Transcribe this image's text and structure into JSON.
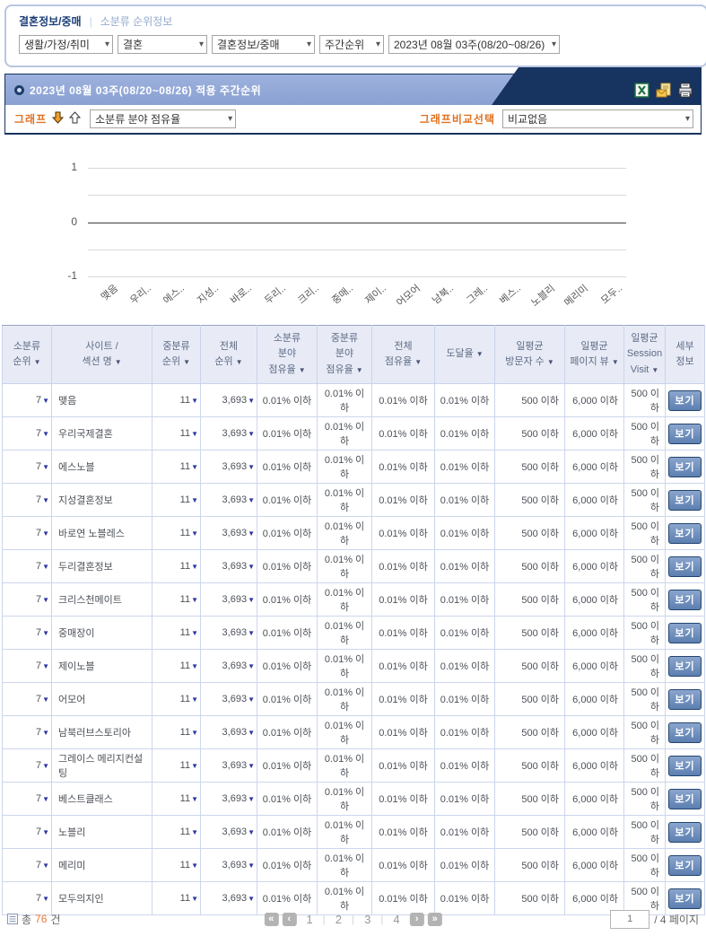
{
  "breadcrumb": {
    "category": "결혼정보/중매",
    "separator": "|",
    "section": "소분류 순위정보"
  },
  "filters": {
    "selects": [
      "생활/가정/취미",
      "결혼",
      "결혼정보/중매",
      "주간순위",
      "2023년 08월 03주(08/20~08/26)"
    ]
  },
  "panel": {
    "title": "2023년 08월 03주(08/20~08/26) 적용 주간순위",
    "toolbar_icons": [
      "excel-export-icon",
      "email-report-icon",
      "print-icon"
    ],
    "graph_label": "그래프",
    "graph_metric_select": "소분류 분야 점유율",
    "compare_label": "그래프비교선택",
    "compare_select": "비교없음"
  },
  "chart_data": {
    "type": "bar",
    "title": "",
    "xlabel": "",
    "ylabel": "",
    "categories": [
      "맺음",
      "우리..",
      "에스..",
      "지성..",
      "바로..",
      "두리..",
      "크리..",
      "중매..",
      "제이..",
      "어모어",
      "남북..",
      "그레..",
      "베스..",
      "노블리",
      "메리미",
      "모두.."
    ],
    "values": [
      0,
      0,
      0,
      0,
      0,
      0,
      0,
      0,
      0,
      0,
      0,
      0,
      0,
      0,
      0,
      0
    ],
    "ylim": [
      -1,
      1
    ],
    "yticks": [
      1,
      0,
      -1
    ],
    "gridline_values": [
      1,
      0.5,
      0,
      -0.5,
      -1
    ],
    "grid": true,
    "legend": false
  },
  "table": {
    "sort_arrow": "▼",
    "headers": [
      {
        "label": "소분류\n순위",
        "sortable": true
      },
      {
        "label": "사이트 /\n섹션 명",
        "sortable": true
      },
      {
        "label": "중분류\n순위",
        "sortable": true
      },
      {
        "label": "전체\n순위",
        "sortable": true
      },
      {
        "label": "소분류\n분야\n점유율",
        "sortable": true
      },
      {
        "label": "중분류\n분야\n점유율",
        "sortable": true
      },
      {
        "label": "전체\n점유율",
        "sortable": true
      },
      {
        "label": "도달율",
        "sortable": true
      },
      {
        "label": "일평균\n방문자 수",
        "sortable": true
      },
      {
        "label": "일평균\n페이지 뷰",
        "sortable": true
      },
      {
        "label": "일평균\nSession\nVisit",
        "sortable": true
      },
      {
        "label": "세부\n정보",
        "sortable": false
      }
    ],
    "detail_button_label": "보기",
    "rows": [
      {
        "rank": "7",
        "site": "맺음",
        "mid_rank": "11",
        "total_rank": "3,693",
        "sub_share": "0.01% 이하",
        "mid_share": "0.01% 이하",
        "total_share": "0.01% 이하",
        "reach": "0.01% 이하",
        "visitors": "500 이하",
        "pageviews": "6,000 이하",
        "sessions": "500 이하"
      },
      {
        "rank": "7",
        "site": "우리국제결혼",
        "mid_rank": "11",
        "total_rank": "3,693",
        "sub_share": "0.01% 이하",
        "mid_share": "0.01% 이하",
        "total_share": "0.01% 이하",
        "reach": "0.01% 이하",
        "visitors": "500 이하",
        "pageviews": "6,000 이하",
        "sessions": "500 이하"
      },
      {
        "rank": "7",
        "site": "에스노블",
        "mid_rank": "11",
        "total_rank": "3,693",
        "sub_share": "0.01% 이하",
        "mid_share": "0.01% 이하",
        "total_share": "0.01% 이하",
        "reach": "0.01% 이하",
        "visitors": "500 이하",
        "pageviews": "6,000 이하",
        "sessions": "500 이하"
      },
      {
        "rank": "7",
        "site": "지성결혼정보",
        "mid_rank": "11",
        "total_rank": "3,693",
        "sub_share": "0.01% 이하",
        "mid_share": "0.01% 이하",
        "total_share": "0.01% 이하",
        "reach": "0.01% 이하",
        "visitors": "500 이하",
        "pageviews": "6,000 이하",
        "sessions": "500 이하"
      },
      {
        "rank": "7",
        "site": "바로연 노블레스",
        "mid_rank": "11",
        "total_rank": "3,693",
        "sub_share": "0.01% 이하",
        "mid_share": "0.01% 이하",
        "total_share": "0.01% 이하",
        "reach": "0.01% 이하",
        "visitors": "500 이하",
        "pageviews": "6,000 이하",
        "sessions": "500 이하"
      },
      {
        "rank": "7",
        "site": "두리결혼정보",
        "mid_rank": "11",
        "total_rank": "3,693",
        "sub_share": "0.01% 이하",
        "mid_share": "0.01% 이하",
        "total_share": "0.01% 이하",
        "reach": "0.01% 이하",
        "visitors": "500 이하",
        "pageviews": "6,000 이하",
        "sessions": "500 이하"
      },
      {
        "rank": "7",
        "site": "크리스천메이트",
        "mid_rank": "11",
        "total_rank": "3,693",
        "sub_share": "0.01% 이하",
        "mid_share": "0.01% 이하",
        "total_share": "0.01% 이하",
        "reach": "0.01% 이하",
        "visitors": "500 이하",
        "pageviews": "6,000 이하",
        "sessions": "500 이하"
      },
      {
        "rank": "7",
        "site": "중매장이",
        "mid_rank": "11",
        "total_rank": "3,693",
        "sub_share": "0.01% 이하",
        "mid_share": "0.01% 이하",
        "total_share": "0.01% 이하",
        "reach": "0.01% 이하",
        "visitors": "500 이하",
        "pageviews": "6,000 이하",
        "sessions": "500 이하"
      },
      {
        "rank": "7",
        "site": "제이노블",
        "mid_rank": "11",
        "total_rank": "3,693",
        "sub_share": "0.01% 이하",
        "mid_share": "0.01% 이하",
        "total_share": "0.01% 이하",
        "reach": "0.01% 이하",
        "visitors": "500 이하",
        "pageviews": "6,000 이하",
        "sessions": "500 이하"
      },
      {
        "rank": "7",
        "site": "어모어",
        "mid_rank": "11",
        "total_rank": "3,693",
        "sub_share": "0.01% 이하",
        "mid_share": "0.01% 이하",
        "total_share": "0.01% 이하",
        "reach": "0.01% 이하",
        "visitors": "500 이하",
        "pageviews": "6,000 이하",
        "sessions": "500 이하"
      },
      {
        "rank": "7",
        "site": "남북러브스토리아",
        "mid_rank": "11",
        "total_rank": "3,693",
        "sub_share": "0.01% 이하",
        "mid_share": "0.01% 이하",
        "total_share": "0.01% 이하",
        "reach": "0.01% 이하",
        "visitors": "500 이하",
        "pageviews": "6,000 이하",
        "sessions": "500 이하"
      },
      {
        "rank": "7",
        "site": "그레이스 메리지컨설팅",
        "mid_rank": "11",
        "total_rank": "3,693",
        "sub_share": "0.01% 이하",
        "mid_share": "0.01% 이하",
        "total_share": "0.01% 이하",
        "reach": "0.01% 이하",
        "visitors": "500 이하",
        "pageviews": "6,000 이하",
        "sessions": "500 이하"
      },
      {
        "rank": "7",
        "site": "베스트클래스",
        "mid_rank": "11",
        "total_rank": "3,693",
        "sub_share": "0.01% 이하",
        "mid_share": "0.01% 이하",
        "total_share": "0.01% 이하",
        "reach": "0.01% 이하",
        "visitors": "500 이하",
        "pageviews": "6,000 이하",
        "sessions": "500 이하"
      },
      {
        "rank": "7",
        "site": "노블리",
        "mid_rank": "11",
        "total_rank": "3,693",
        "sub_share": "0.01% 이하",
        "mid_share": "0.01% 이하",
        "total_share": "0.01% 이하",
        "reach": "0.01% 이하",
        "visitors": "500 이하",
        "pageviews": "6,000 이하",
        "sessions": "500 이하"
      },
      {
        "rank": "7",
        "site": "메리미",
        "mid_rank": "11",
        "total_rank": "3,693",
        "sub_share": "0.01% 이하",
        "mid_share": "0.01% 이하",
        "total_share": "0.01% 이하",
        "reach": "0.01% 이하",
        "visitors": "500 이하",
        "pageviews": "6,000 이하",
        "sessions": "500 이하"
      },
      {
        "rank": "7",
        "site": "모두의지인",
        "mid_rank": "11",
        "total_rank": "3,693",
        "sub_share": "0.01% 이하",
        "mid_share": "0.01% 이하",
        "total_share": "0.01% 이하",
        "reach": "0.01% 이하",
        "visitors": "500 이하",
        "pageviews": "6,000 이하",
        "sessions": "500 이하"
      }
    ]
  },
  "footer": {
    "summary_prefix": "총",
    "total_count": "76",
    "summary_suffix": "건",
    "pages": [
      "1",
      "2",
      "3",
      "4"
    ],
    "current_page": "1",
    "page_input_value": "1",
    "page_total_label": "/ 4 페이지"
  },
  "colors": {
    "navy": "#17335f",
    "header_blue": "#8ea6d6",
    "accent_orange": "#e0711f",
    "count_orange": "#e87a3c",
    "sort_arrow_blue": "#2d35a0",
    "table_header_bg": "#e8ebf6"
  }
}
